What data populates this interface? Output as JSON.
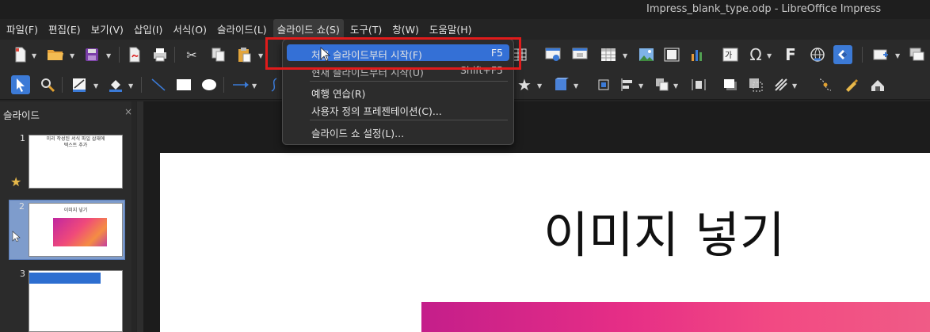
{
  "window": {
    "title": "Impress_blank_type.odp - LibreOffice Impress"
  },
  "menubar": {
    "items": [
      {
        "label": "파일(F)"
      },
      {
        "label": "편집(E)"
      },
      {
        "label": "보기(V)"
      },
      {
        "label": "삽입(I)"
      },
      {
        "label": "서식(O)"
      },
      {
        "label": "슬라이드(L)"
      },
      {
        "label": "슬라이드 쇼(S)"
      },
      {
        "label": "도구(T)"
      },
      {
        "label": "창(W)"
      },
      {
        "label": "도움말(H)"
      }
    ],
    "active_index": 6
  },
  "dropdown": {
    "items": [
      {
        "label": "처음 슬라이드부터 시작(F)",
        "shortcut": "F5"
      },
      {
        "label": "현재 슬라이드부터 시작(U)",
        "shortcut": "Shift+F5"
      },
      {
        "label": "예행 연습(R)",
        "shortcut": ""
      },
      {
        "label": "사용자 정의 프레젠테이션(C)...",
        "shortcut": ""
      },
      {
        "label": "슬라이드 쇼 설정(L)...",
        "shortcut": ""
      }
    ]
  },
  "slides_pane": {
    "title": "슬라이드",
    "close": "×",
    "slides": [
      {
        "number": "1",
        "text": "미리 작성된 서식 파일 삽재에\n텍스트 추가"
      },
      {
        "number": "2",
        "text": "이미지 넣기"
      },
      {
        "number": "3",
        "text": ""
      }
    ]
  },
  "slide": {
    "title": "이미지 넣기"
  },
  "toolbar_glyphs": {
    "omega": "Ω",
    "fontwork": "F",
    "star": "★"
  },
  "colors": {
    "highlight": "#3470d6",
    "red_annotation": "#e01b1b",
    "image_gradient_start": "#c41e8a",
    "image_gradient_end": "#f05b86"
  }
}
